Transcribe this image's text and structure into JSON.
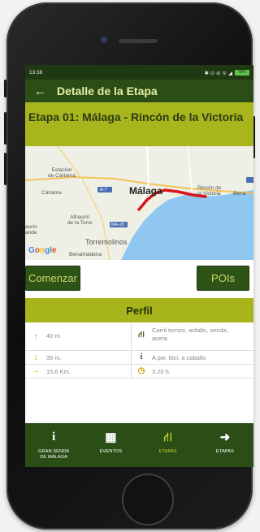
{
  "statusbar": {
    "time": "13:38",
    "icons": "✱ ⊙ ⊘ ᯤ ◢",
    "battery": "78%"
  },
  "appbar": {
    "back_icon": "←",
    "title": "Detalle de la Etapa"
  },
  "stage": {
    "title": "Etapa 01: Málaga - Rincón de la Victoria"
  },
  "map": {
    "labels": {
      "estacion": "Estación\nde Cártama",
      "cartama": "Cártama",
      "a7": "A-7",
      "malaga": "Málaga",
      "rincon": "Rincón de\nla Victoria",
      "bena": "Bena",
      "alhaurin_torre": "Alhaurín\nde la Torre",
      "ma20": "MA-20",
      "alhaurin_grande": "aurín\nande",
      "torremolinos": "Torremolinos",
      "benalmadena": "Benalmádena",
      "google": "Google"
    },
    "colors": {
      "sea": "#8fc7f0",
      "route": "#d7141c",
      "land": "#eef0e6"
    }
  },
  "actions": {
    "start_label": "Comenzar",
    "pois_label": "POIs"
  },
  "profile": {
    "title": "Perfil",
    "rows": [
      {
        "left_icon": "arrow-up-icon",
        "left": "40 m.",
        "right_icon": "road-icon",
        "right": "Carril terrizo, asfalto, senda, acera"
      },
      {
        "left_icon": "arrow-down-icon",
        "left": "35 m.",
        "right_icon": "info-icon",
        "right": "A pie, bici, a caballo"
      },
      {
        "left_icon": "arrow-right-icon",
        "left": "15,6 Km.",
        "right_icon": "clock-icon",
        "right": "3.20 h."
      }
    ]
  },
  "bottomnav": {
    "items": [
      {
        "label": "GRAN SENDA\nDE MÁLAGA",
        "icon": "info-icon",
        "glyph": "i",
        "active": false
      },
      {
        "label": "EVENTOS",
        "icon": "calendar-icon",
        "glyph": "▦",
        "active": false
      },
      {
        "label": "ETAPAS",
        "icon": "road-icon",
        "glyph": "⛙",
        "active": true
      },
      {
        "label": "ETAPAS",
        "icon": "sign-in-icon",
        "glyph": "➜",
        "active": false
      }
    ]
  }
}
